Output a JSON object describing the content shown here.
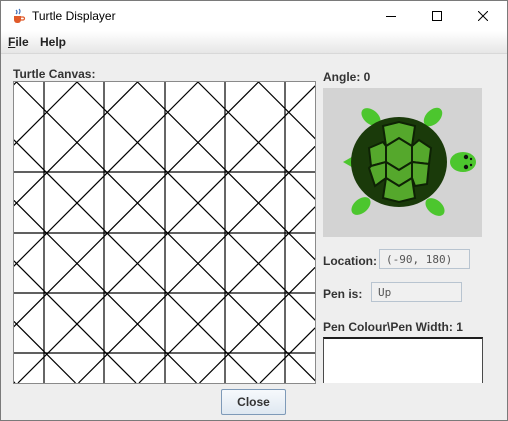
{
  "window": {
    "title": "Turtle Displayer"
  },
  "menu": {
    "file_mnemonic": "F",
    "file_rest": "ile",
    "help_label": "Help"
  },
  "canvas": {
    "label": "Turtle Canvas:",
    "line_color": "#000000",
    "background": "#ffffff"
  },
  "angle": {
    "label": "Angle: 0"
  },
  "location": {
    "label": "Location:",
    "value": "(-90, 180)"
  },
  "pen": {
    "label": "Pen is:",
    "value": "Up",
    "colour_width_label": "Pen Colour\\Pen Width: 1"
  },
  "buttons": {
    "close_label": "Close"
  },
  "colors": {
    "turtle_shell": "#1a3a0a",
    "turtle_body": "#4cc62e",
    "turtle_bg": "#d3d3d3"
  },
  "icons": {
    "app": "java-cup-icon",
    "minimize": "minimize-icon",
    "maximize": "maximize-icon",
    "close": "close-icon"
  }
}
